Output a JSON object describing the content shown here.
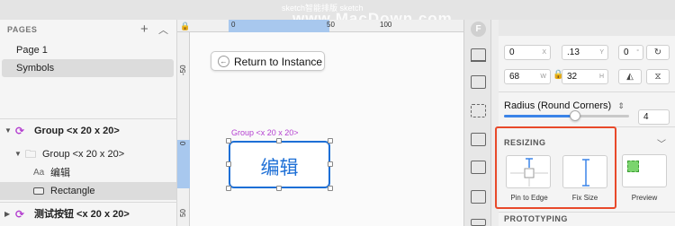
{
  "watermark": {
    "line1": "sketch智能排版 sketch",
    "line2": "www.MacDown.com"
  },
  "layers_panel": {
    "pages_header": "PAGES",
    "pages": [
      {
        "label": "Page 1",
        "selected": false
      },
      {
        "label": "Symbols",
        "selected": true
      }
    ],
    "layers": [
      {
        "label": "Group <x 20 x 20>",
        "icon": "symbol-icon",
        "bold": true
      },
      {
        "label": "Group <x 20 x 20>",
        "icon": "folder-icon",
        "bold": false
      },
      {
        "label": "编辑",
        "icon": "text-icon",
        "bold": false
      },
      {
        "label": "Rectangle",
        "icon": "rectangle-icon",
        "bold": false,
        "selected": true
      },
      {
        "label": "测试按钮 <x 20 x 20>",
        "icon": "symbol-icon",
        "bold": true
      }
    ]
  },
  "canvas": {
    "ruler_top": [
      "0",
      "50",
      "100"
    ],
    "ruler_left": [
      "-50",
      "0",
      "50"
    ],
    "return_button": "Return to Instance",
    "group_label": "Group <x 20 x 20>",
    "symbol_text": "编辑",
    "accent_color": "#1d6fd6",
    "group_color": "#b43fd0"
  },
  "inspector": {
    "row1": {
      "x": "0",
      "x_suffix": "X",
      "y": ".13",
      "y_suffix": "Y",
      "rotation": "0",
      "rotation_suffix": "°"
    },
    "row2": {
      "w": "68",
      "w_suffix": "W",
      "h": "32",
      "h_suffix": "H"
    },
    "radius_label": "Radius (Round Corners)",
    "radius_value": "4",
    "radius_fraction": 0.57,
    "resizing_title": "RESIZING",
    "pin_caption": "Pin to Edge",
    "fix_caption": "Fix Size",
    "preview_caption": "Preview",
    "prototyping_title": "PROTOTYPING",
    "highlight_color": "#e8492a"
  }
}
